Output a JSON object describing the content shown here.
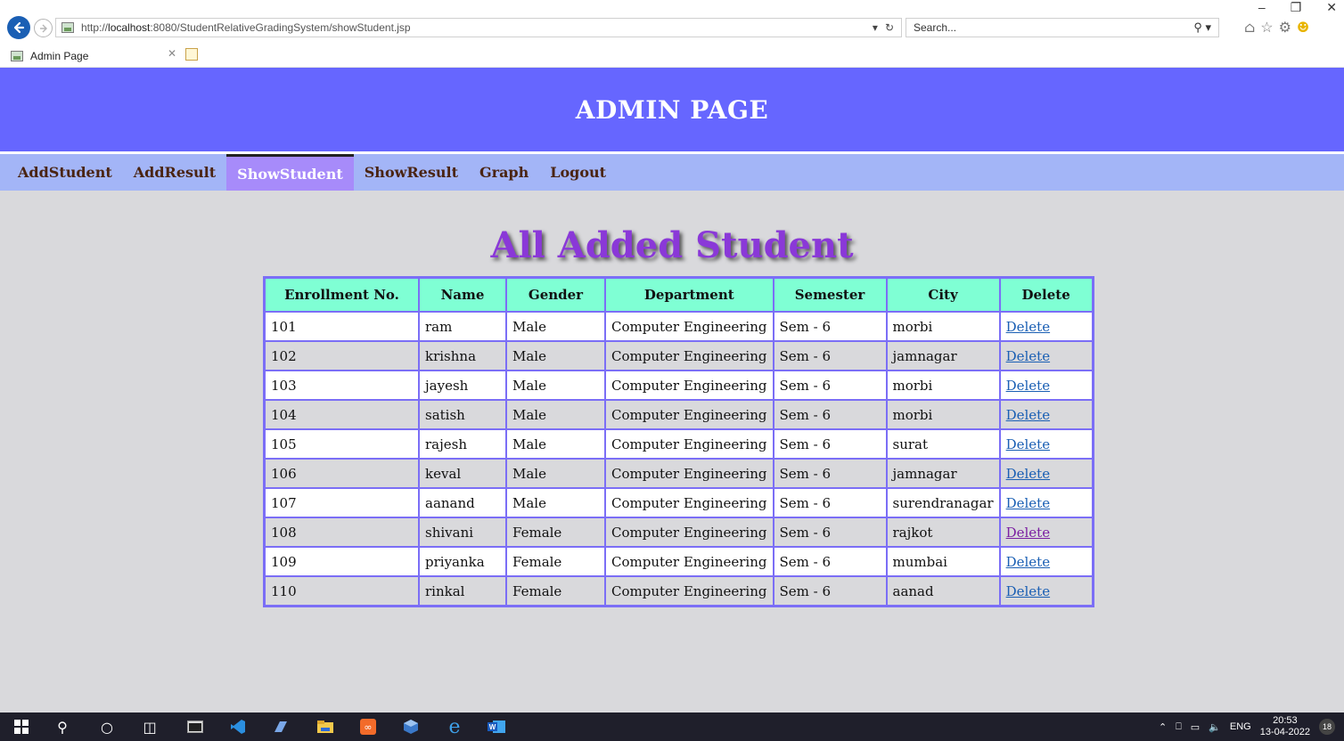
{
  "browser": {
    "url_prefix": "http://",
    "url_host": "localhost",
    "url_rest": ":8080/StudentRelativeGradingSystem/showStudent.jsp",
    "search_placeholder": "Search...",
    "tab_title": "Admin Page"
  },
  "header": {
    "title": "ADMIN PAGE"
  },
  "nav": {
    "items": [
      {
        "label": "AddStudent",
        "active": false
      },
      {
        "label": "AddResult",
        "active": false
      },
      {
        "label": "ShowStudent",
        "active": true
      },
      {
        "label": "ShowResult",
        "active": false
      },
      {
        "label": "Graph",
        "active": false
      },
      {
        "label": "Logout",
        "active": false
      }
    ]
  },
  "main": {
    "title": "All Added Student",
    "table": {
      "columns": [
        "Enrollment No.",
        "Name",
        "Gender",
        "Department",
        "Semester",
        "City",
        "Delete"
      ],
      "rows": [
        [
          "101",
          "ram",
          "Male",
          "Computer Engineering",
          "Sem - 6",
          "morbi",
          "Delete"
        ],
        [
          "102",
          "krishna",
          "Male",
          "Computer Engineering",
          "Sem - 6",
          "jamnagar",
          "Delete"
        ],
        [
          "103",
          "jayesh",
          "Male",
          "Computer Engineering",
          "Sem - 6",
          "morbi",
          "Delete"
        ],
        [
          "104",
          "satish",
          "Male",
          "Computer Engineering",
          "Sem - 6",
          "morbi",
          "Delete"
        ],
        [
          "105",
          "rajesh",
          "Male",
          "Computer Engineering",
          "Sem - 6",
          "surat",
          "Delete"
        ],
        [
          "106",
          "keval",
          "Male",
          "Computer Engineering",
          "Sem - 6",
          "jamnagar",
          "Delete"
        ],
        [
          "107",
          "aanand",
          "Male",
          "Computer Engineering",
          "Sem - 6",
          "surendranagar",
          "Delete"
        ],
        [
          "108",
          "shivani",
          "Female",
          "Computer Engineering",
          "Sem - 6",
          "rajkot",
          "Delete"
        ],
        [
          "109",
          "priyanka",
          "Female",
          "Computer Engineering",
          "Sem - 6",
          "mumbai",
          "Delete"
        ],
        [
          "110",
          "rinkal",
          "Female",
          "Computer Engineering",
          "Sem - 6",
          "aanad",
          "Delete"
        ]
      ],
      "visited_row_index": 7
    }
  },
  "taskbar": {
    "language": "ENG",
    "time": "20:53",
    "date": "13-04-2022",
    "notification_count": "18"
  },
  "colors": {
    "header_bg": "#6666ff",
    "nav_bg": "#a3b5f7",
    "nav_active_bg": "#a78bfa",
    "table_header_bg": "#7fffd4",
    "table_border": "#7b6ef6",
    "title_color": "#8a38d8"
  }
}
